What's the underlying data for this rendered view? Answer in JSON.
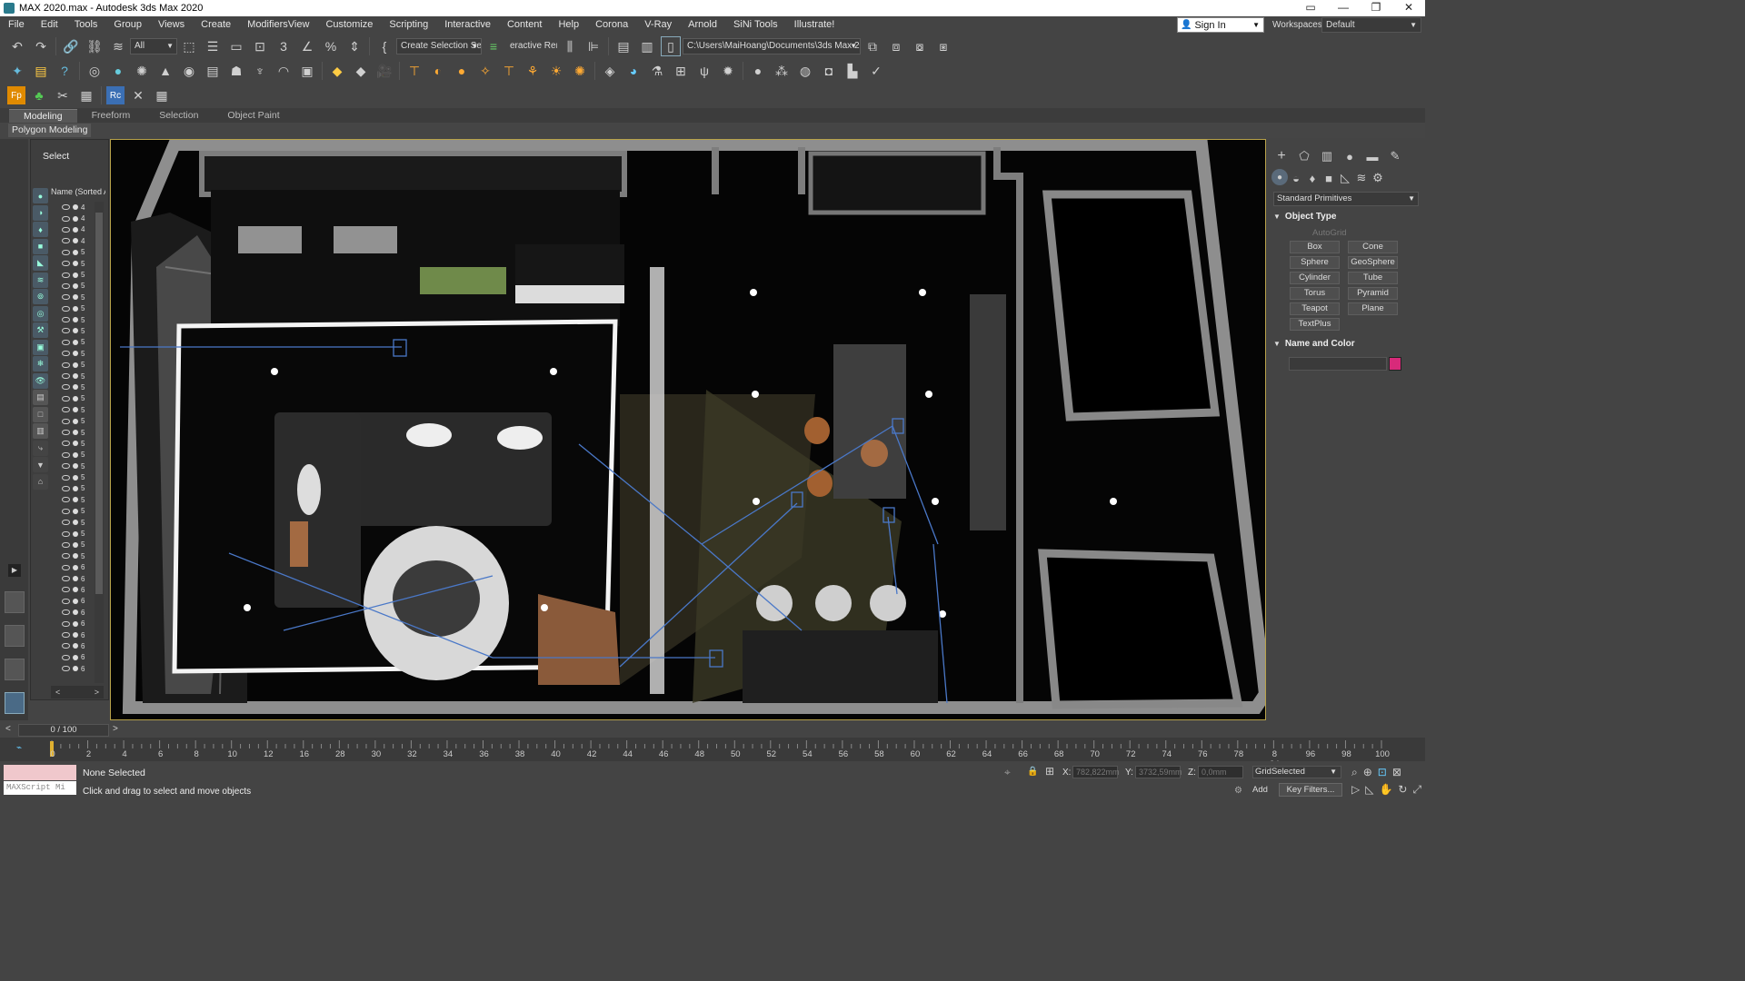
{
  "titlebar": {
    "title": "MAX 2020.max - Autodesk 3ds Max 2020",
    "buttons": [
      "▭",
      "—",
      "❐",
      "✕"
    ]
  },
  "menu": [
    "File",
    "Edit",
    "Tools",
    "Group",
    "Views",
    "Create",
    "ModifiersView",
    "Customize",
    "Scripting",
    "Interactive",
    "Content",
    "Help",
    "Corona",
    "V-Ray",
    "Arnold",
    "SiNi Tools",
    "Illustrate!"
  ],
  "signin": {
    "label": "Sign In"
  },
  "workspaces": {
    "label": "Workspaces:",
    "value": "Default"
  },
  "toolbar1": {
    "filter": "All",
    "selection_set": "Create Selection Se",
    "render": "eractive Renai",
    "project_path": "C:\\Users\\MaiHoang\\Documents\\3ds Max 2020"
  },
  "ribbon": {
    "tabs": [
      "Modeling",
      "Freeform",
      "Selection",
      "Object Paint"
    ],
    "active_tab": "Modeling",
    "panel": "Polygon Modeling"
  },
  "scene_explorer": {
    "select_label": "Select",
    "name_header": "Name (Sorted A",
    "row_markers": [
      "4",
      "4",
      "4",
      "4",
      "5",
      "5",
      "5",
      "5",
      "5",
      "5",
      "5",
      "5",
      "5",
      "5",
      "5",
      "5",
      "5",
      "5",
      "5",
      "5",
      "5",
      "5",
      "5",
      "5",
      "5",
      "5",
      "5",
      "5",
      "5",
      "5",
      "5",
      "5",
      "6",
      "6",
      "6",
      "6",
      "6",
      "6",
      "6",
      "6",
      "6",
      "6"
    ]
  },
  "command_panel": {
    "category": "Standard Primitives",
    "object_type": "Object Type",
    "autogrid": "AutoGrid",
    "buttons": [
      "Box",
      "Cone",
      "Sphere",
      "GeoSphere",
      "Cylinder",
      "Tube",
      "Torus",
      "Pyramid",
      "Teapot",
      "Plane",
      "TextPlus"
    ],
    "name_and_color": "Name and Color",
    "color": "#d82a7a"
  },
  "timeline": {
    "frame": "0 / 100",
    "ticks": [
      "0",
      "2",
      "4",
      "6",
      "8",
      "10",
      "12",
      "16",
      "28",
      "30",
      "32",
      "34",
      "36",
      "38",
      "40",
      "42",
      "44",
      "46",
      "48",
      "50",
      "52",
      "54",
      "56",
      "58",
      "60",
      "62",
      "64",
      "66",
      "68",
      "70",
      "72",
      "74",
      "76",
      "78",
      "8 94",
      "96",
      "98",
      "100"
    ]
  },
  "status": {
    "selection": "None Selected",
    "prompt": "Click and drag to select and move objects",
    "maxscript": "MAXScript Mi",
    "x_label": "X:",
    "x_value": "782,822mm",
    "y_label": "Y:",
    "y_value": "3732,59mm",
    "z_label": "Z:",
    "z_value": "0,0mm",
    "grid": "Grid",
    "selected": "Selected",
    "add_time_tag": "Add",
    "key_filters": "Key Filters..."
  }
}
